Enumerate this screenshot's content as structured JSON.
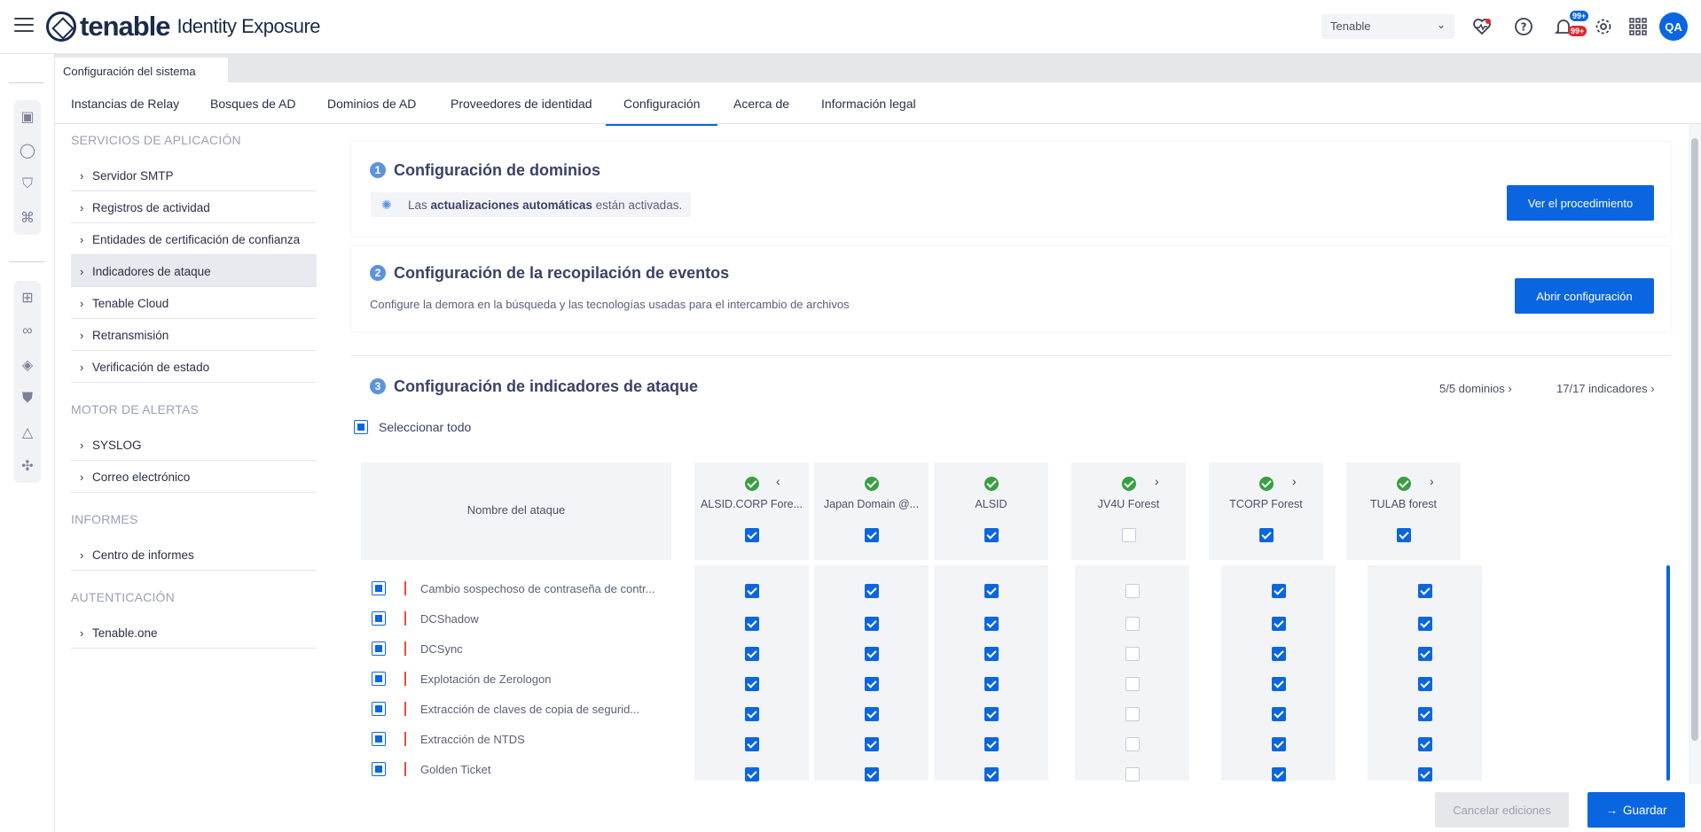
{
  "app": {
    "brand": "tenable",
    "product": "Identity Exposure"
  },
  "header": {
    "tenant": "Tenable",
    "notifications_badge_top": "99+",
    "notifications_badge_bottom": "99+",
    "user_initials": "QA"
  },
  "page_tab": "Configuración del sistema",
  "navtabs": [
    "Instancias de Relay",
    "Bosques de AD",
    "Dominios de AD",
    "Proveedores de identidad",
    "Configuración",
    "Acerca de",
    "Información legal"
  ],
  "sidebar": {
    "sections": [
      {
        "title": "SERVICIOS DE APLICACIÓN",
        "items": [
          "Servidor SMTP",
          "Registros de actividad",
          "Entidades de certificación de confianza",
          "Indicadores de ataque",
          "Tenable Cloud",
          "Retransmisión",
          "Verificación de estado"
        ]
      },
      {
        "title": "MOTOR DE ALERTAS",
        "items": [
          "SYSLOG",
          "Correo electrónico"
        ]
      },
      {
        "title": "INFORMES",
        "items": [
          "Centro de informes"
        ]
      },
      {
        "title": "AUTENTICACIÓN",
        "items": [
          "Tenable.one"
        ]
      }
    ],
    "active_item": "Indicadores de ataque"
  },
  "domains_config": {
    "number": "1",
    "title": "Configuración de dominios",
    "status_prefix": "Las",
    "status_bold": "actualizaciones automáticas",
    "status_suffix": "están activadas.",
    "button": "Ver el procedimiento"
  },
  "events_config": {
    "number": "2",
    "title": "Configuración de la recopilación de eventos",
    "description": "Configure la demora en la búsqueda y las tecnologías usadas para el intercambio de archivos",
    "button": "Abrir configuración"
  },
  "ioa_config": {
    "number": "3",
    "title": "Configuración de indicadores de ataque",
    "domains_link": "5/5 dominios",
    "indicators_link": "17/17 indicadores",
    "select_all": "Seleccionar todo",
    "attack_name_header": "Nombre del ataque",
    "columns": [
      {
        "name": "ALSID.CORP Fore...",
        "checked": true
      },
      {
        "name": "Japan Domain @...",
        "checked": true
      },
      {
        "name": "ALSID",
        "checked": true
      },
      {
        "name": "JV4U Forest",
        "checked": false
      },
      {
        "name": "TCORP Forest",
        "checked": true
      },
      {
        "name": "TULAB forest",
        "checked": true
      }
    ],
    "attacks": [
      "Cambio sospechoso de contraseña de contr...",
      "DCShadow",
      "DCSync",
      "Explotación de Zerologon",
      "Extracción de claves de copia de segurid...",
      "Extracción de NTDS",
      "Golden Ticket"
    ]
  },
  "footer": {
    "cancel": "Cancelar ediciones",
    "save": "Guardar"
  },
  "colors": {
    "accent": "#0a66e0",
    "success": "#37a03f",
    "danger": "#e0503f"
  }
}
